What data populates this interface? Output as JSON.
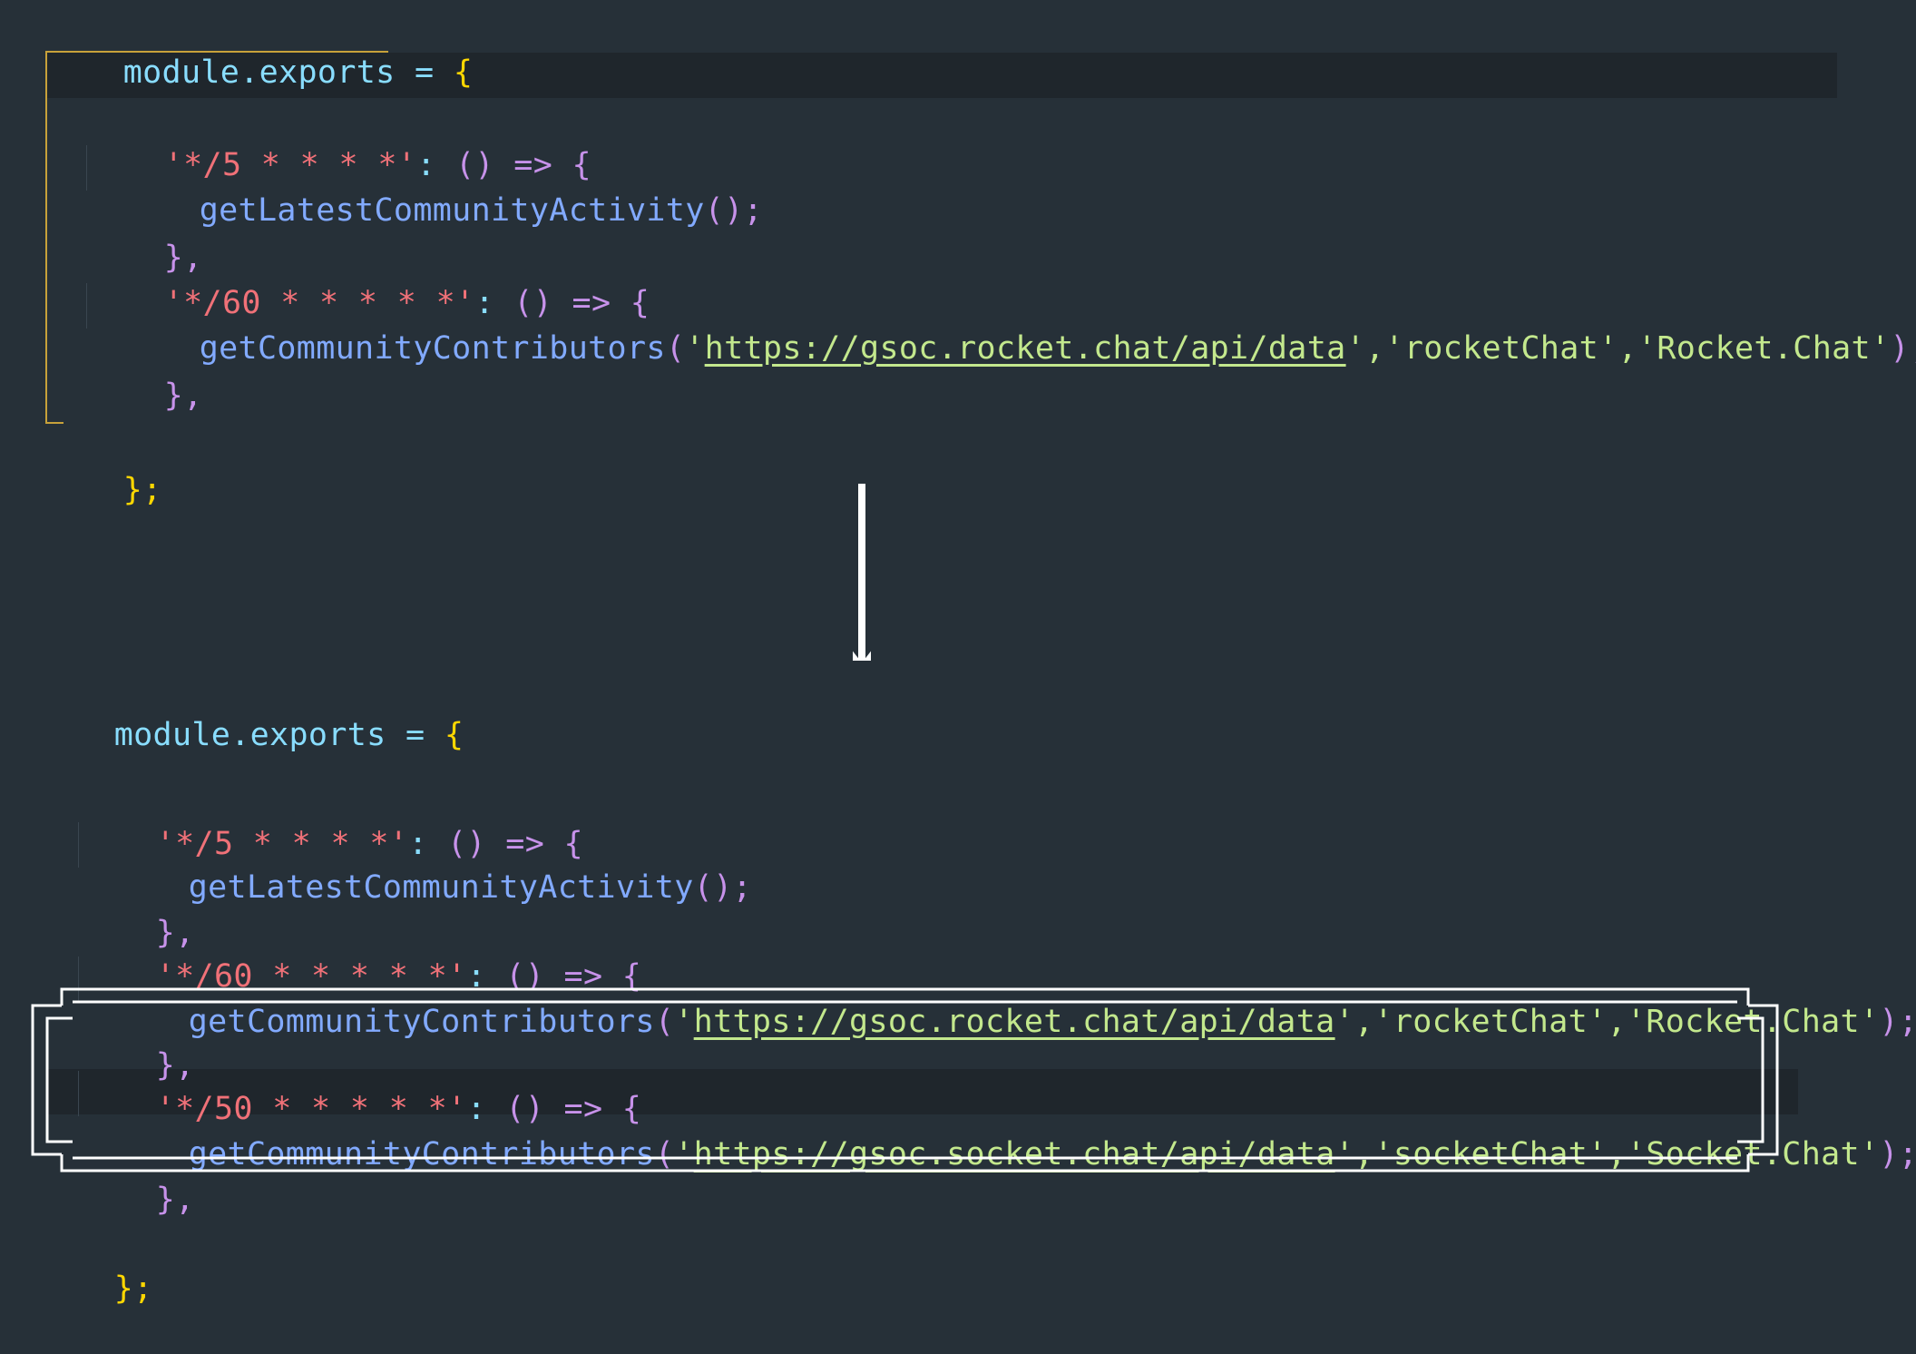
{
  "before": {
    "lines": [
      {
        "t1": "module",
        "t2": ".",
        "t3": "exports",
        "t4": " = ",
        "t5": "{"
      },
      {
        "k": "'*/5 * * * *'",
        "c": ": ",
        "p": "() => {"
      },
      {
        "fn": "getLatestCommunityActivity",
        "rest": "();"
      },
      {
        "close": "},"
      },
      {
        "k": "'*/60 * * * * *'",
        "c": ": ",
        "p": "() => {"
      },
      {
        "fn": "getCommunityContributors",
        "open": "(",
        "q1": "'",
        "url": "https://gsoc.rocket.chat/api/data",
        "q2": "'",
        "s2": ",'rocketChat'",
        "s3": ",'Rocket.Chat'",
        "end": ");"
      },
      {
        "close": "},"
      },
      {
        "end": "};"
      }
    ]
  },
  "after": {
    "lines": [
      {
        "t1": "module",
        "t2": ".",
        "t3": "exports",
        "t4": " = ",
        "t5": "{"
      },
      {
        "k": "'*/5 * * * *'",
        "c": ": ",
        "p": "() => {"
      },
      {
        "fn": "getLatestCommunityActivity",
        "rest": "();"
      },
      {
        "close": "},"
      },
      {
        "k": "'*/60 * * * * *'",
        "c": ": ",
        "p": "() => {"
      },
      {
        "fn": "getCommunityContributors",
        "open": "(",
        "q1": "'",
        "url": "https://gsoc.rocket.chat/api/data",
        "q2": "'",
        "s2": ",'rocketChat'",
        "s3": ",'Rocket.Chat'",
        "end": ");"
      },
      {
        "close": "},"
      },
      {
        "k": "'*/50 * * * * *'",
        "c": ": ",
        "p": "() => {"
      },
      {
        "fn": "getCommunityContributors",
        "open": "(",
        "q1": "'",
        "url": "https://gsoc.socket.chat/api/data",
        "q2": "'",
        "s2": ",'socketChat'",
        "s3": ",'Socket.Chat'",
        "end": ");"
      },
      {
        "close": "},"
      },
      {
        "end": "};"
      }
    ]
  },
  "colors": {
    "background": "#263038",
    "accent_arrow": "#ffffff",
    "highlight_frame": "#ffffff"
  }
}
